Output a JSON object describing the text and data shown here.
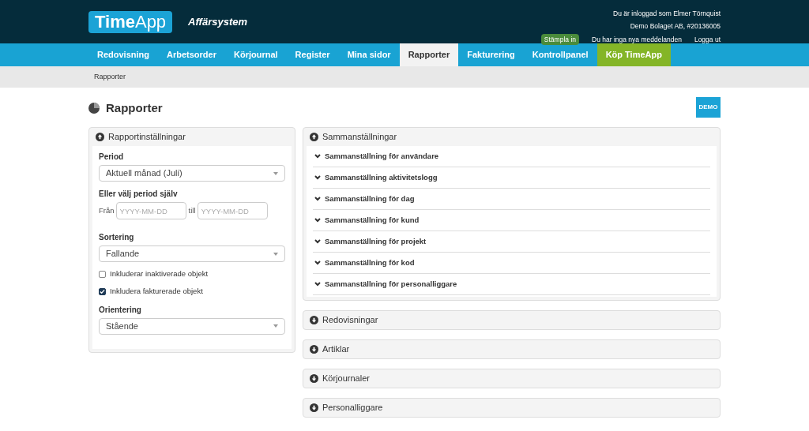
{
  "header": {
    "logo": "**Time**App",
    "subtitle": "Affärsystem",
    "user_line": "Du är inloggad som Elmer Törnquist",
    "company_line": "Demo Bolaget AB, #20136005",
    "stamp_button": "Stämpla in",
    "messages": "Du har inga nya meddelanden",
    "logout": "Logga ut"
  },
  "nav": [
    {
      "label": "Redovisning",
      "selected": false,
      "kind": "tab"
    },
    {
      "label": "Arbetsorder",
      "selected": false,
      "kind": "tab"
    },
    {
      "label": "Körjournal",
      "selected": false,
      "kind": "tab"
    },
    {
      "label": "Register",
      "selected": false,
      "kind": "tab"
    },
    {
      "label": "Mina sidor",
      "selected": false,
      "kind": "tab"
    },
    {
      "label": "Rapporter",
      "selected": true,
      "kind": "tab"
    },
    {
      "label": "Fakturering",
      "selected": false,
      "kind": "tab"
    },
    {
      "label": "Kontrollpanel",
      "selected": false,
      "kind": "tab"
    },
    {
      "label": "Köp TimeApp",
      "selected": false,
      "kind": "promo"
    }
  ],
  "breadcrumb": "Rapporter",
  "page_title": "Rapporter",
  "demo_badge": "DEMO",
  "settings": {
    "title": "Rapportinställningar",
    "expanded": true,
    "period_label": "Period",
    "period_value": "Aktuell månad (Juli)",
    "custom_label": "Eller välj period själv",
    "from_label": "Från",
    "from_placeholder": "YYYY-MM-DD",
    "to_label": "till",
    "to_placeholder": "YYYY-MM-DD",
    "sort_label": "Sortering",
    "sort_value": "Fallande",
    "checkboxes": [
      {
        "label": "Inkluderar inaktiverade objekt",
        "checked": false
      },
      {
        "label": "Inkludera fakturerade objekt",
        "checked": true
      }
    ],
    "orientation_label": "Orientering",
    "orientation_value": "Stående"
  },
  "sections": [
    {
      "title": "Sammanställningar",
      "expanded": true,
      "items": [
        "Sammanställning för användare",
        "Sammanställning aktivitetslogg",
        "Sammanställning för dag",
        "Sammanställning för kund",
        "Sammanställning för projekt",
        "Sammanställning för kod",
        "Sammanställning för personalliggare"
      ]
    },
    {
      "title": "Redovisningar",
      "expanded": false
    },
    {
      "title": "Artiklar",
      "expanded": false
    },
    {
      "title": "Körjournaler",
      "expanded": false
    },
    {
      "title": "Personalliggare",
      "expanded": false
    }
  ]
}
